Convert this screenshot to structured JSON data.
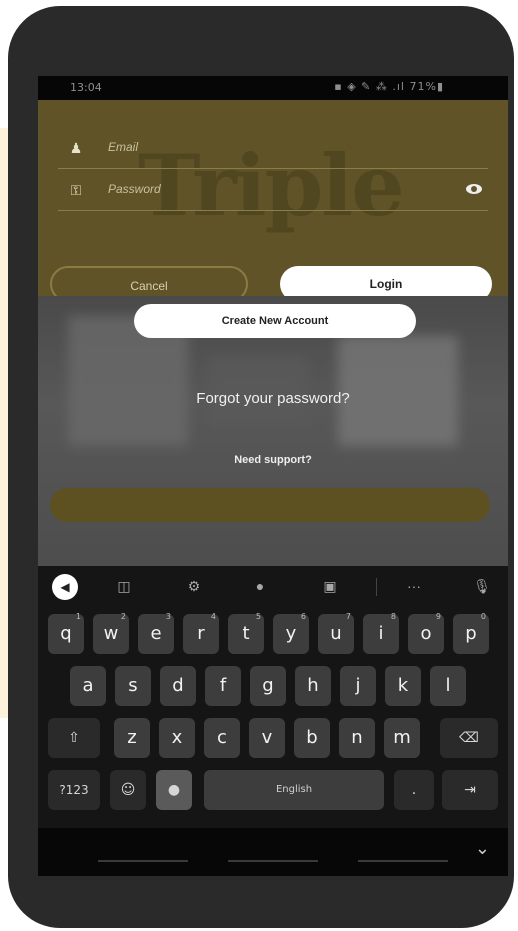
{
  "status_bar": {
    "time": "13:04",
    "icons_text": "▪ ◈ ✎ ⁂ .ıl 71%▮"
  },
  "app": {
    "watermark": "Triple",
    "email_placeholder": "Email",
    "password_placeholder": "Password",
    "cancel_label": "Cancel",
    "login_label": "Login",
    "create_account_label": "Create New Account",
    "forgot_password": "Forgot your password?",
    "need_support": "Need support?",
    "colors": {
      "gold": "#5f5327",
      "button_white": "#ffffff"
    }
  },
  "keyboard": {
    "toolbar_icons": [
      "back-icon",
      "clipboard-icon",
      "settings-icon",
      "palette-icon",
      "screenshot-icon",
      "more-icon",
      "microphone-icon"
    ],
    "row1": [
      "q",
      "w",
      "e",
      "r",
      "t",
      "y",
      "u",
      "i",
      "o",
      "p"
    ],
    "row1_hints": [
      "1",
      "2",
      "3",
      "4",
      "5",
      "6",
      "7",
      "8",
      "9",
      "0"
    ],
    "row2": [
      "a",
      "s",
      "d",
      "f",
      "g",
      "h",
      "j",
      "k",
      "l"
    ],
    "row3": [
      "z",
      "x",
      "c",
      "v",
      "b",
      "n",
      "m"
    ],
    "symbols_key": "?123",
    "space_label": "English",
    "period_key": "."
  }
}
